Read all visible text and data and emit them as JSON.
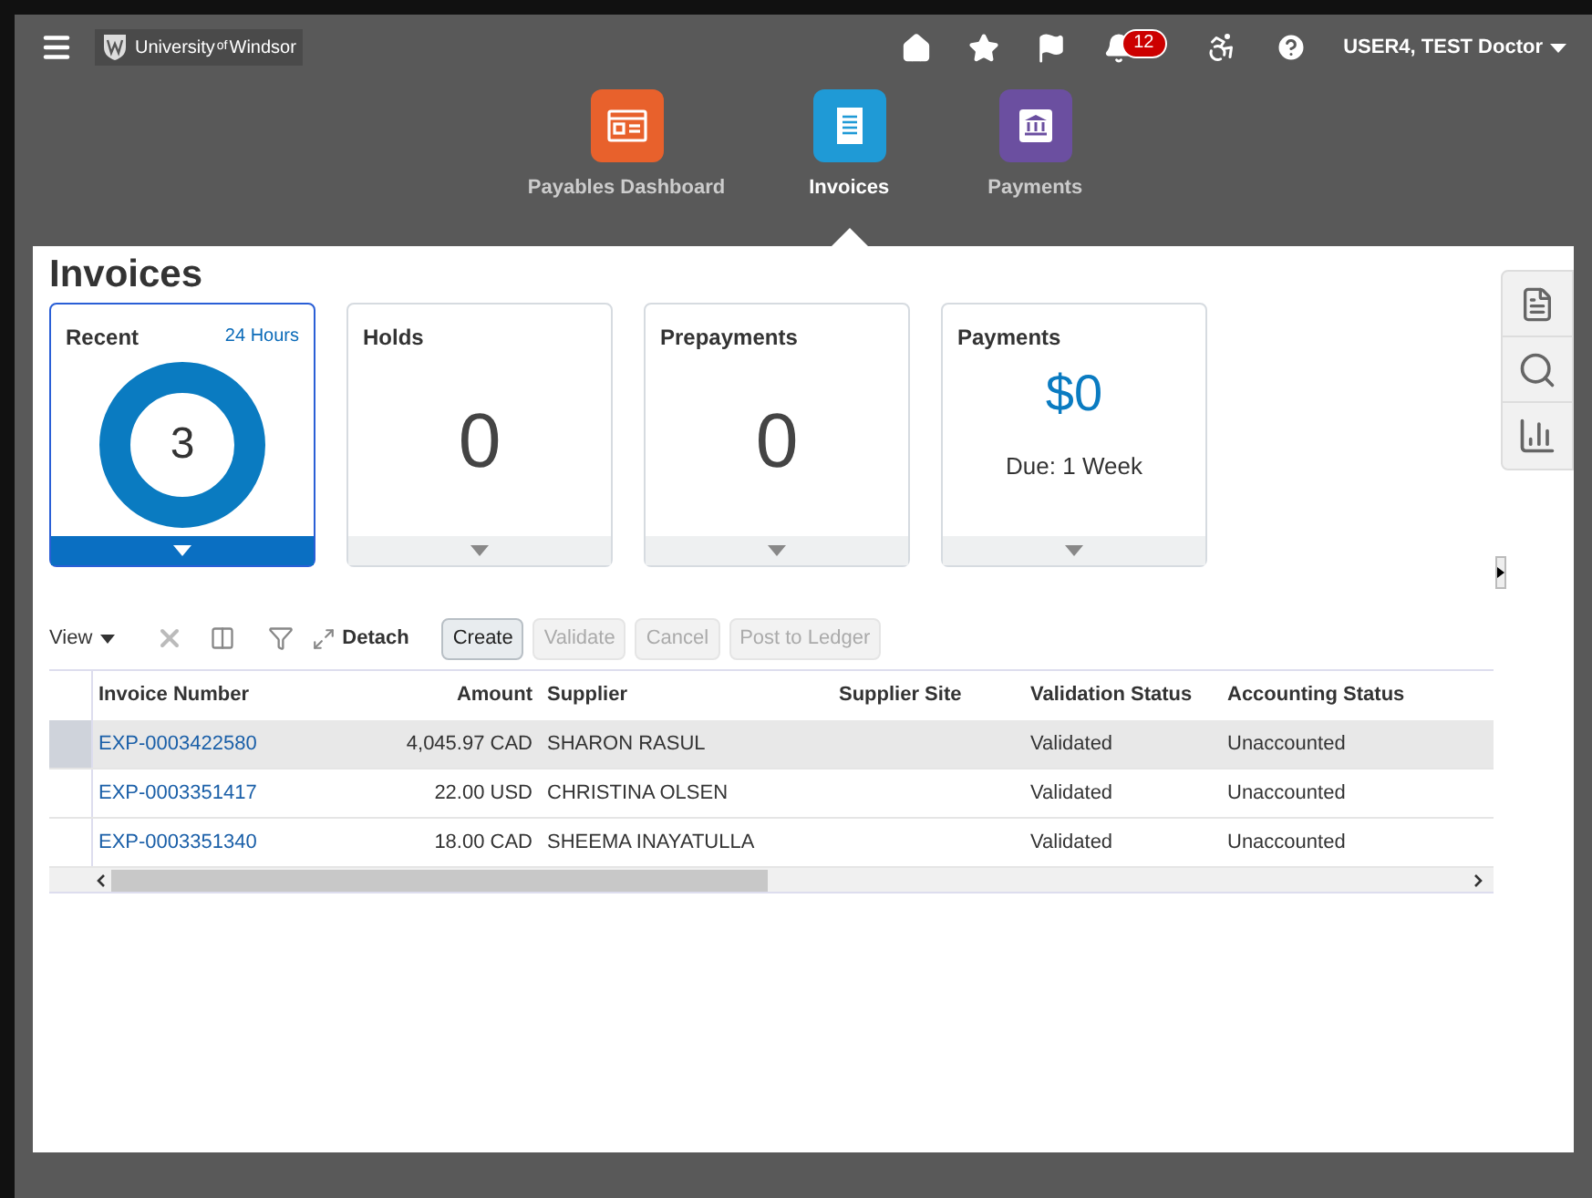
{
  "header": {
    "logo": [
      "University",
      "of",
      "Windsor"
    ],
    "notifications_count": "12",
    "user": "USER4, TEST Doctor"
  },
  "apps": [
    {
      "label": "Payables Dashboard",
      "kind": "dashboard",
      "selected": false
    },
    {
      "label": "Invoices",
      "kind": "document",
      "selected": true
    },
    {
      "label": "Payments",
      "kind": "bank",
      "selected": false
    }
  ],
  "page_title": "Invoices",
  "tiles": [
    {
      "kind": "donut",
      "title": "Recent",
      "subtitle": "24 Hours",
      "value": "3",
      "selected": true
    },
    {
      "kind": "count",
      "title": "Holds",
      "value": "0",
      "selected": false
    },
    {
      "kind": "count",
      "title": "Prepayments",
      "value": "0",
      "selected": false
    },
    {
      "kind": "amount",
      "title": "Payments",
      "value": "$0",
      "note": "Due: 1 Week",
      "selected": false
    }
  ],
  "toolbar": {
    "view": "View",
    "detach": "Detach",
    "buttons": [
      {
        "label": "Create",
        "disabled": false
      },
      {
        "label": "Validate",
        "disabled": true
      },
      {
        "label": "Cancel",
        "disabled": true
      },
      {
        "label": "Post to Ledger",
        "disabled": true
      }
    ]
  },
  "table": {
    "columns": [
      "Invoice Number",
      "Amount",
      "Supplier",
      "Supplier Site",
      "Validation Status",
      "Accounting Status"
    ],
    "rows": [
      {
        "invoice": "EXP-0003422580",
        "amount": "4,045.97 CAD",
        "supplier": "SHARON RASUL",
        "site": "",
        "validation": "Validated",
        "accounting": "Unaccounted",
        "selected": true
      },
      {
        "invoice": "EXP-0003351417",
        "amount": "22.00 USD",
        "supplier": "CHRISTINA OLSEN",
        "site": "",
        "validation": "Validated",
        "accounting": "Unaccounted",
        "selected": false
      },
      {
        "invoice": "EXP-0003351340",
        "amount": "18.00 CAD",
        "supplier": "SHEEMA INAYATULLA",
        "site": "",
        "validation": "Validated",
        "accounting": "Unaccounted",
        "selected": false
      }
    ]
  }
}
